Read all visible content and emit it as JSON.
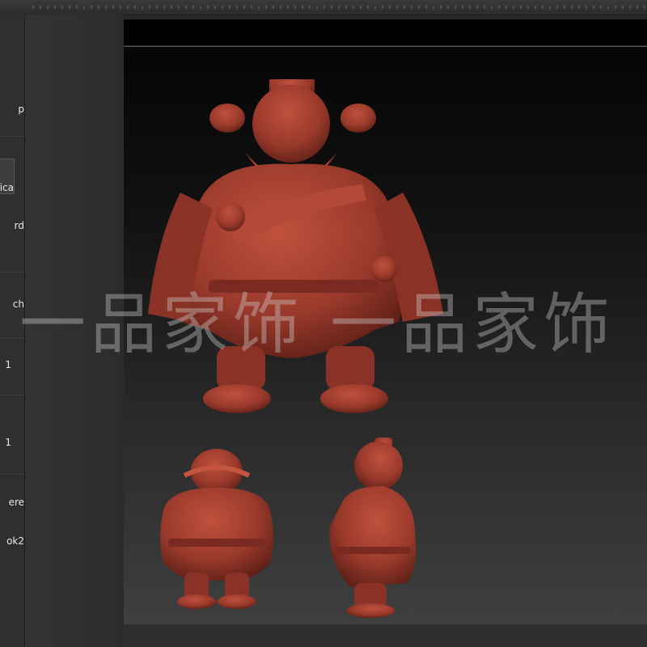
{
  "left_panel": {
    "items": [
      "p",
      "gica",
      "rd",
      "ch",
      "1",
      "1",
      "ere",
      "ok2"
    ]
  },
  "watermark": "一品家饰 一品家饰",
  "colors": {
    "model": "#9a3a2c",
    "model_highlight": "#c0513d",
    "model_shadow": "#5e1f16",
    "viewport_top": "#000000",
    "panel": "#2f2f2f"
  }
}
